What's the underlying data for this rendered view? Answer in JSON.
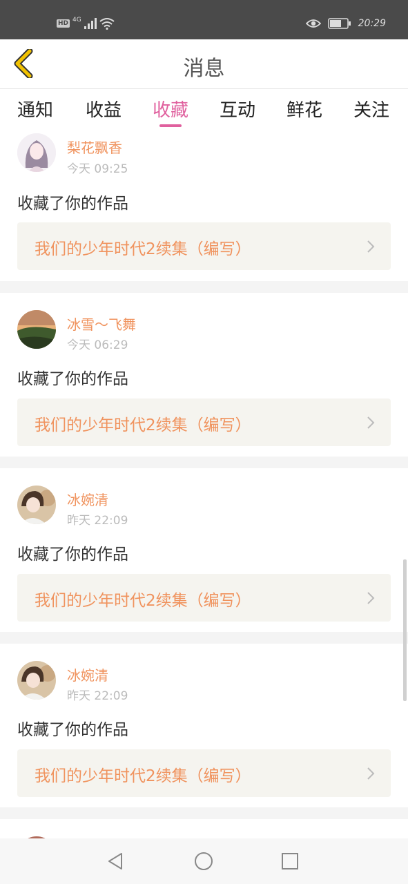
{
  "status_bar": {
    "hd_label": "HD",
    "network_label": "4G",
    "time": "20:29",
    "icons": [
      "signal-icon",
      "wifi-icon",
      "eye-icon",
      "battery-icon"
    ]
  },
  "header": {
    "title": "消息",
    "back_icon": "chevron-left-icon"
  },
  "tabs": [
    {
      "label": "通知"
    },
    {
      "label": "收益"
    },
    {
      "label": "收藏"
    },
    {
      "label": "互动"
    },
    {
      "label": "鲜花"
    },
    {
      "label": "关注"
    }
  ],
  "active_tab": "收藏",
  "messages": [
    {
      "user": "梨花飘香",
      "time": "今天 09:25",
      "action": "收藏了你的作品",
      "work": "我们的少年时代2续集（编写）"
    },
    {
      "user": "冰雪～飞舞",
      "time": "今天 06:29",
      "action": "收藏了你的作品",
      "work": "我们的少年时代2续集（编写）"
    },
    {
      "user": "冰婉清",
      "time": "昨天 22:09",
      "action": "收藏了你的作品",
      "work": "我们的少年时代2续集（编写）"
    },
    {
      "user": "冰婉清",
      "time": "昨天 22:09",
      "action": "收藏了你的作品",
      "work": "我们的少年时代2续集（编写）"
    }
  ],
  "colors": {
    "accent": "#e0609e",
    "username": "#f0935e",
    "back_arrow": "#f2c200",
    "status_bar": "#4a4a4a"
  },
  "nav_bar": {
    "buttons": [
      "back-triangle-icon",
      "home-circle-icon",
      "recents-square-icon"
    ]
  }
}
